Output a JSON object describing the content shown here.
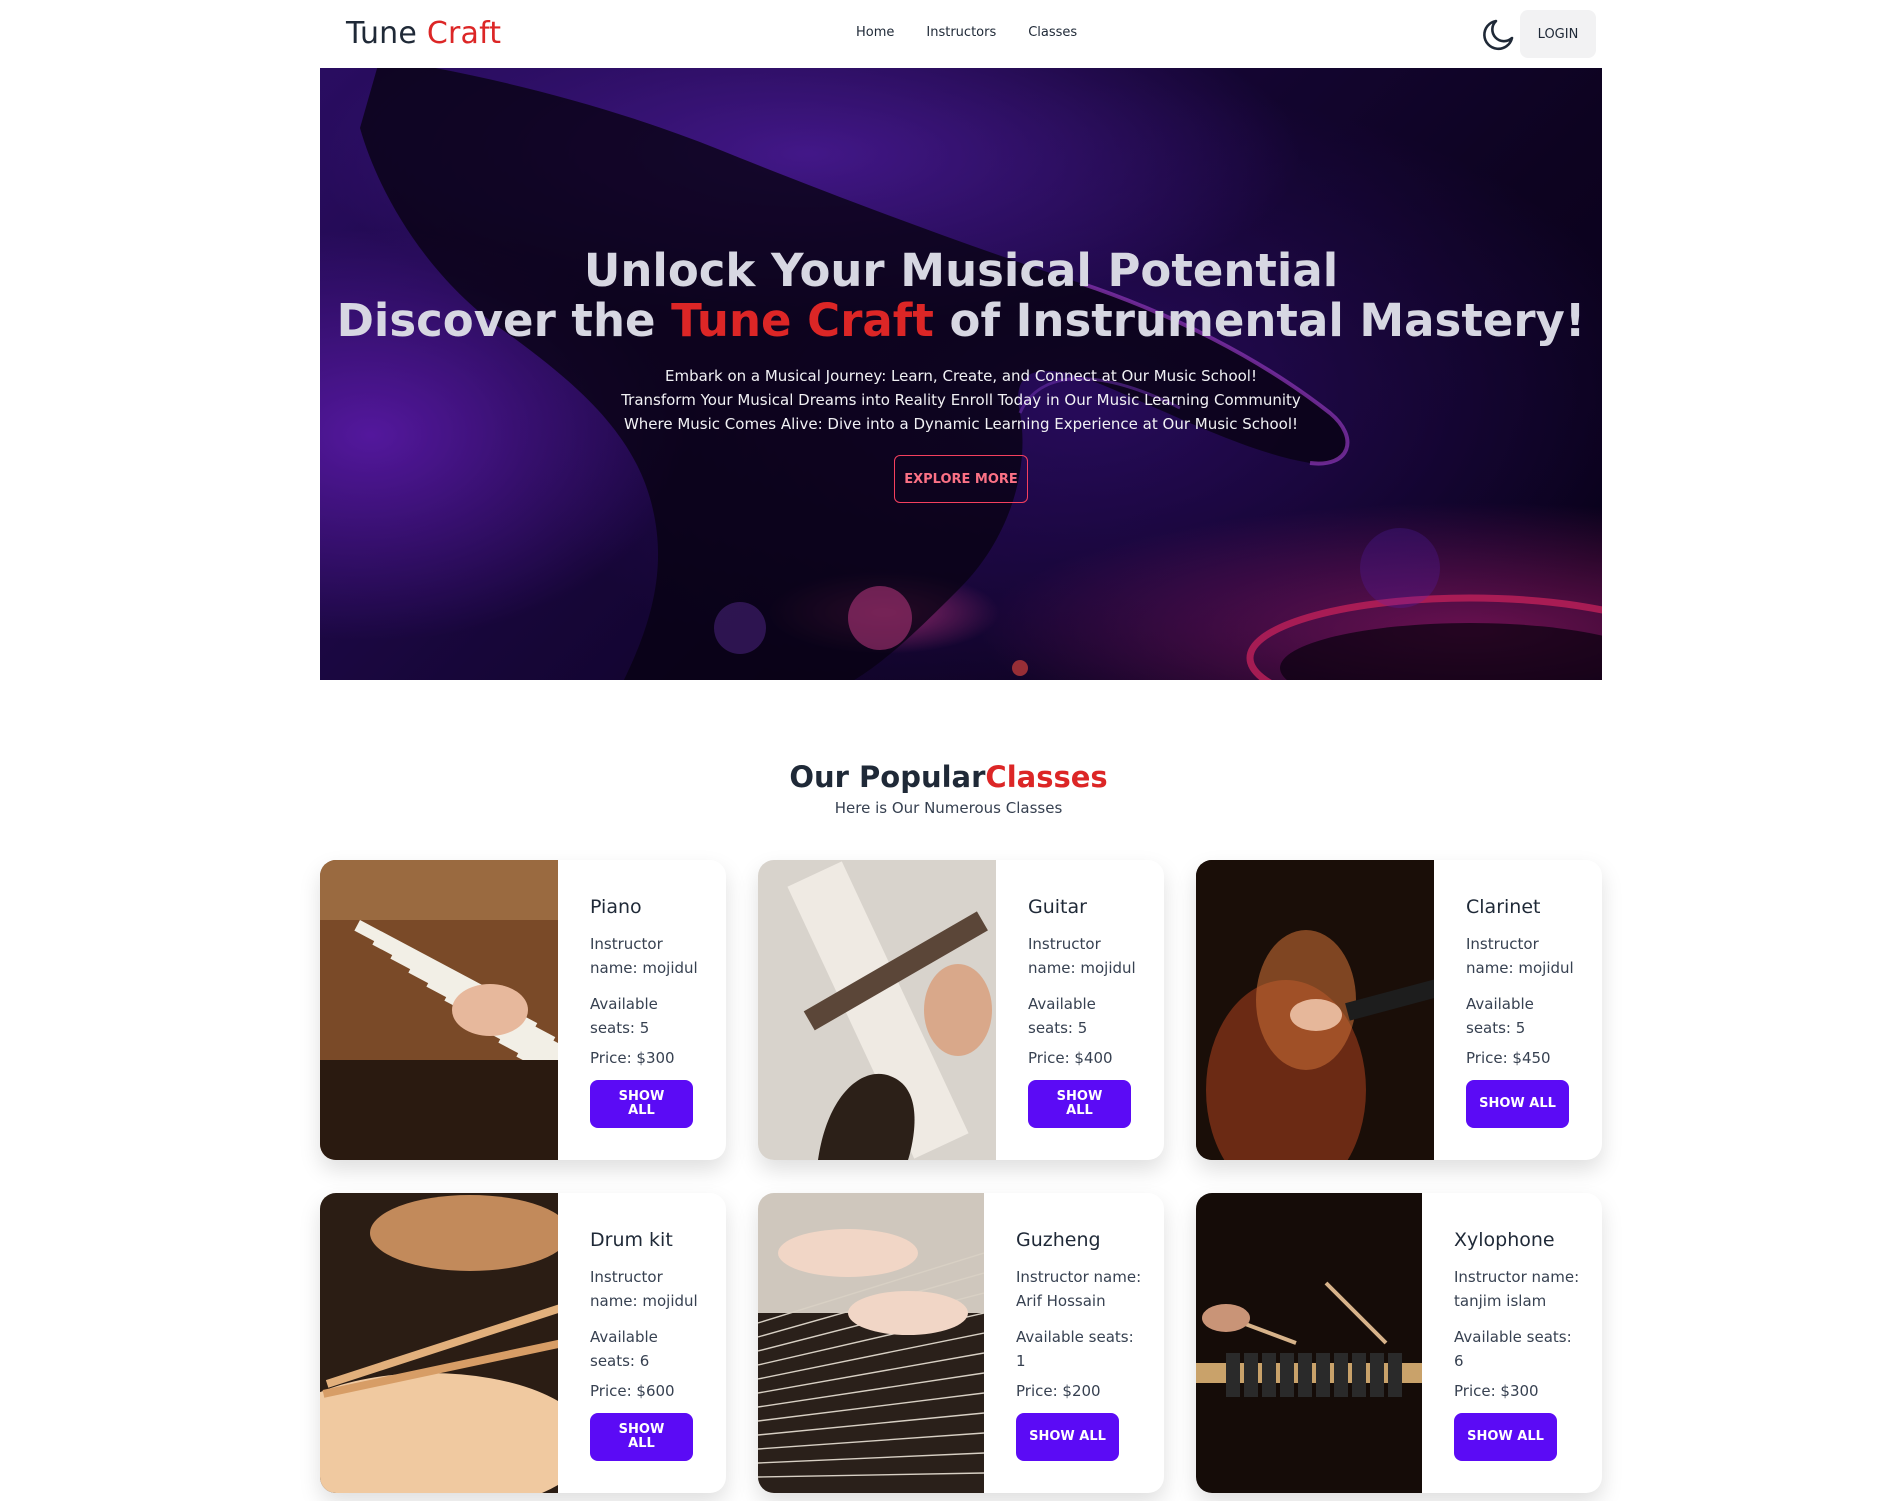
{
  "header": {
    "brand_part1": "Tune",
    "brand_part2": "Craft",
    "nav": [
      "Home",
      "Instructors",
      "Classes"
    ],
    "theme_icon": "moon-icon",
    "login_label": "LOGIN"
  },
  "hero": {
    "title_line1": "Unlock Your Musical Potential",
    "title_line2_before": "Discover the ",
    "title_line2_accent": "Tune Craft",
    "title_line2_after": " of Instrumental Mastery!",
    "subtitles": [
      "Embark on a Musical Journey: Learn, Create, and Connect at Our Music School!",
      "Transform Your Musical Dreams into Reality Enroll Today in Our Music Learning Community",
      "Where Music Comes Alive: Dive into a Dynamic Learning Experience at Our Music School!"
    ],
    "cta_label": "EXPLORE MORE"
  },
  "popular": {
    "title_part1": "Our Popular",
    "title_part2": "Classes",
    "subtitle": "Here is Our Numerous Classes",
    "classes": [
      {
        "name": "Piano",
        "instructor_lines": [
          "Instructor",
          "name: mojidul"
        ],
        "seats_lines": [
          "Available",
          "seats: 5"
        ],
        "price": "Price: $300",
        "button_lines": [
          "SHOW",
          "ALL"
        ]
      },
      {
        "name": "Guitar",
        "instructor_lines": [
          "Instructor",
          "name: mojidul"
        ],
        "seats_lines": [
          "Available",
          "seats: 5"
        ],
        "price": "Price: $400",
        "button_lines": [
          "SHOW",
          "ALL"
        ]
      },
      {
        "name": "Clarinet",
        "instructor_lines": [
          "Instructor",
          "name: mojidul"
        ],
        "seats_lines": [
          "Available",
          "seats: 5"
        ],
        "price": "Price: $450",
        "button_lines": [
          "SHOW ALL"
        ]
      },
      {
        "name": "Drum kit",
        "instructor_lines": [
          "Instructor",
          "name: mojidul"
        ],
        "seats_lines": [
          "Available",
          "seats: 6"
        ],
        "price": "Price: $600",
        "button_lines": [
          "SHOW",
          "ALL"
        ]
      },
      {
        "name": "Guzheng",
        "instructor_lines": [
          "Instructor name:",
          "Arif Hossain"
        ],
        "seats_lines": [
          "Available seats:",
          "1"
        ],
        "price": "Price: $200",
        "button_lines": [
          "SHOW ALL"
        ]
      },
      {
        "name": "Xylophone",
        "instructor_lines": [
          "Instructor name:",
          "tanjim islam"
        ],
        "seats_lines": [
          "Available seats:",
          "6"
        ],
        "price": "Price: $300",
        "button_lines": [
          "SHOW ALL"
        ]
      }
    ]
  },
  "colors": {
    "accent_red": "#dc2626",
    "button_purple": "#5b0bf5",
    "cta_border": "#f43f5e"
  }
}
